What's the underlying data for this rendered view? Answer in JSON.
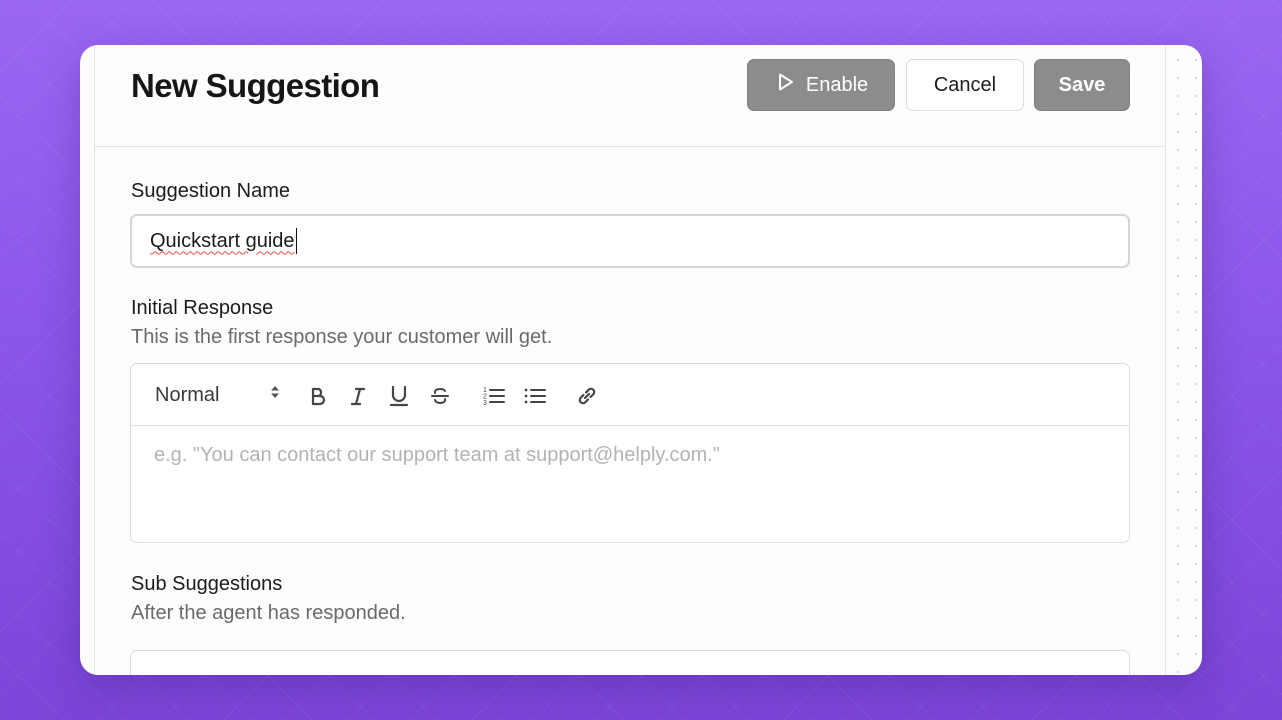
{
  "header": {
    "title": "New Suggestion",
    "enable_label": "Enable",
    "cancel_label": "Cancel",
    "save_label": "Save"
  },
  "suggestion_name": {
    "label": "Suggestion Name",
    "value": "Quickstart guide"
  },
  "initial_response": {
    "label": "Initial Response",
    "helper": "This is the first response your customer will get.",
    "format_value": "Normal",
    "placeholder": "e.g. \"You can contact our support team at support@helply.com.\"",
    "toolbar_icons": [
      "bold-icon",
      "italic-icon",
      "underline-icon",
      "strikethrough-icon",
      "ordered-list-icon",
      "bullet-list-icon",
      "link-icon"
    ]
  },
  "sub_suggestions": {
    "label": "Sub Suggestions",
    "helper": "After the agent has responded."
  },
  "colors": {
    "background": "#8b56ea",
    "disabled_button": "#8c8c8c"
  }
}
